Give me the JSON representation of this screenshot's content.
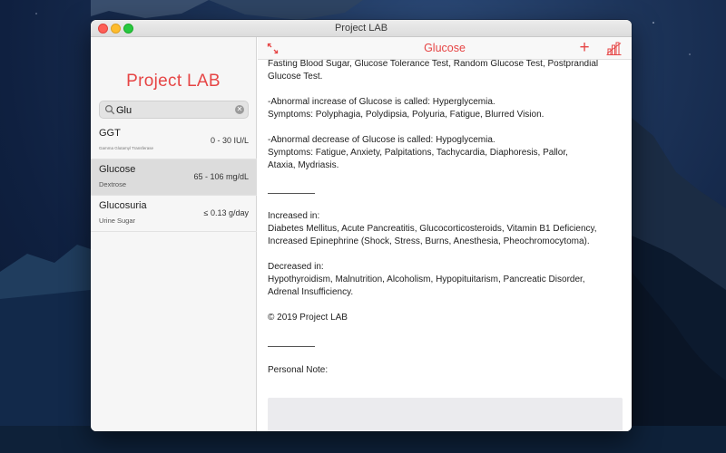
{
  "window": {
    "title": "Project LAB"
  },
  "sidebar": {
    "logo": "Project LAB",
    "search": {
      "value": "Glu"
    },
    "results": [
      {
        "name": "GGT",
        "subtitle": "Gamma Glutamyl Transferase",
        "range": "0 - 30 IU/L",
        "selected": false
      },
      {
        "name": "Glucose",
        "subtitle": "Dextrose",
        "range": "65 - 106 mg/dL",
        "selected": true
      },
      {
        "name": "Glucosuria",
        "subtitle": "Urine Sugar",
        "range": "≤ 0.13 g/day",
        "selected": false
      }
    ]
  },
  "main": {
    "title": "Glucose",
    "paragraphs": [
      [
        "Fasting Blood Sugar, Glucose Tolerance Test, Random Glucose Test, Postprandial",
        "Glucose Test."
      ],
      [
        "-Abnormal increase of Glucose is called: Hyperglycemia.",
        "Symptoms: Polyphagia, Polydipsia, Polyuria, Fatigue, Blurred Vision."
      ],
      [
        "-Abnormal decrease of Glucose is called: Hypoglycemia.",
        "Symptoms: Fatigue, Anxiety, Palpitations, Tachycardia, Diaphoresis, Pallor,",
        "Ataxia, Mydriasis."
      ],
      [
        "Increased in:",
        "Diabetes Mellitus, Acute Pancreatitis, Glucocorticosteroids, Vitamin B1 Deficiency,",
        "Increased Epinephrine (Shock, Stress, Burns, Anesthesia, Pheochromocytoma)."
      ],
      [
        "Decreased in:",
        "Hypothyroidism, Malnutrition, Alcoholism, Hypopituitarism, Pancreatic Disorder,",
        "Adrenal Insufficiency."
      ],
      [
        "© 2019 Project LAB"
      ]
    ],
    "personal_note_label": "Personal Note:",
    "personal_note_value": ""
  },
  "icons": {
    "expand": "expand-arrows-icon",
    "add": "plus-icon",
    "chart": "chart-icon",
    "search": "search-icon",
    "clear": "clear-icon"
  },
  "colors": {
    "accent": "#e64545",
    "sidebar_bg": "#f6f6f6",
    "selected_row": "#dcdcdc"
  }
}
